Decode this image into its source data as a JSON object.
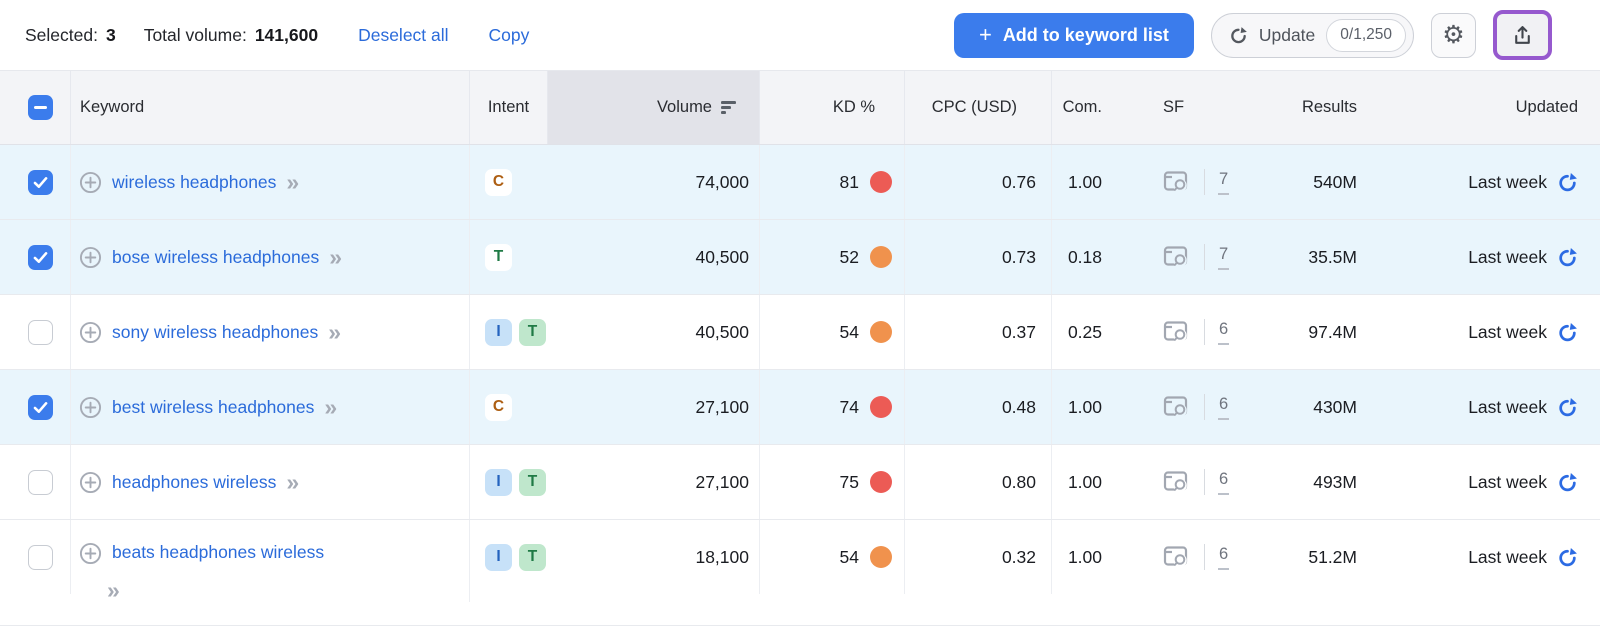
{
  "toolbar": {
    "selected_label": "Selected:",
    "selected_count": "3",
    "total_volume_label": "Total volume:",
    "total_volume_value": "141,600",
    "deselect_all_label": "Deselect all",
    "copy_label": "Copy",
    "add_plus": "+",
    "add_to_list_label": "Add to keyword list",
    "update_label": "Update",
    "update_counter": "0/1,250",
    "gear_icon": "gear-icon",
    "export_icon": "export-upload-icon"
  },
  "header": {
    "keyword": "Keyword",
    "intent": "Intent",
    "volume": "Volume",
    "kd": "KD %",
    "cpc": "CPC (USD)",
    "com": "Com.",
    "sf": "SF",
    "results": "Results",
    "updated": "Updated"
  },
  "rows": [
    {
      "selected": true,
      "keyword": "wireless headphones",
      "intents": [
        "c"
      ],
      "volume": "74,000",
      "kd": "81",
      "kd_level": "red",
      "cpc": "0.76",
      "com": "1.00",
      "sf": "7",
      "results": "540M",
      "updated": "Last week",
      "wrap_chevron": false
    },
    {
      "selected": true,
      "keyword": "bose wireless headphones",
      "intents": [
        "t"
      ],
      "volume": "40,500",
      "kd": "52",
      "kd_level": "orange",
      "cpc": "0.73",
      "com": "0.18",
      "sf": "7",
      "results": "35.5M",
      "updated": "Last week",
      "wrap_chevron": false
    },
    {
      "selected": false,
      "keyword": "sony wireless headphones",
      "intents": [
        "i",
        "t"
      ],
      "volume": "40,500",
      "kd": "54",
      "kd_level": "orange",
      "cpc": "0.37",
      "com": "0.25",
      "sf": "6",
      "results": "97.4M",
      "updated": "Last week",
      "wrap_chevron": false
    },
    {
      "selected": true,
      "keyword": "best wireless headphones",
      "intents": [
        "c"
      ],
      "volume": "27,100",
      "kd": "74",
      "kd_level": "red",
      "cpc": "0.48",
      "com": "1.00",
      "sf": "6",
      "results": "430M",
      "updated": "Last week",
      "wrap_chevron": false
    },
    {
      "selected": false,
      "keyword": "headphones wireless",
      "intents": [
        "i",
        "t"
      ],
      "volume": "27,100",
      "kd": "75",
      "kd_level": "red",
      "cpc": "0.80",
      "com": "1.00",
      "sf": "6",
      "results": "493M",
      "updated": "Last week",
      "wrap_chevron": false
    },
    {
      "selected": false,
      "keyword": "beats headphones wireless",
      "intents": [
        "i",
        "t"
      ],
      "volume": "18,100",
      "kd": "54",
      "kd_level": "orange",
      "cpc": "0.32",
      "com": "1.00",
      "sf": "6",
      "results": "51.2M",
      "updated": "Last week",
      "wrap_chevron": true
    }
  ],
  "colors": {
    "accent_blue": "#3b7cec",
    "link_blue": "#2b6bda",
    "selected_row_bg": "#e9f5fc",
    "kd_red": "#ec5b55",
    "kd_orange": "#f0924d",
    "intent_commercial_text": "#ad5e12",
    "intent_informational_text": "#2463be",
    "intent_transactional_text": "#1f7a45",
    "purple_highlight": "#9659ce",
    "refresh_blue": "#2c6be3"
  }
}
